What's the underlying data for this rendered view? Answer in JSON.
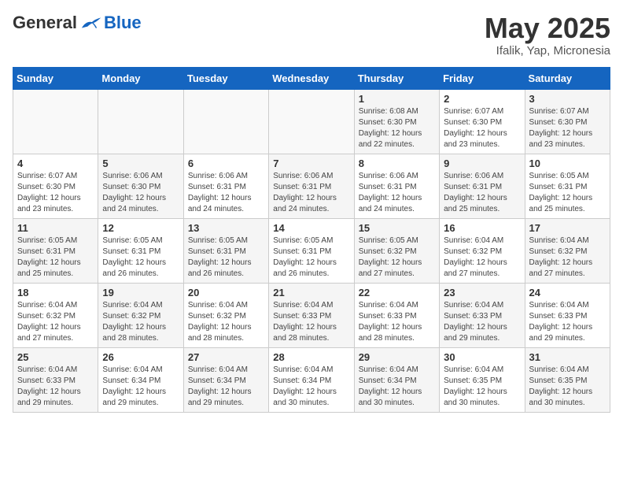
{
  "header": {
    "logo_general": "General",
    "logo_blue": "Blue",
    "month_title": "May 2025",
    "location": "Ifalik, Yap, Micronesia"
  },
  "days_of_week": [
    "Sunday",
    "Monday",
    "Tuesday",
    "Wednesday",
    "Thursday",
    "Friday",
    "Saturday"
  ],
  "weeks": [
    [
      {
        "day": "",
        "info": ""
      },
      {
        "day": "",
        "info": ""
      },
      {
        "day": "",
        "info": ""
      },
      {
        "day": "",
        "info": ""
      },
      {
        "day": "1",
        "info": "Sunrise: 6:08 AM\nSunset: 6:30 PM\nDaylight: 12 hours\nand 22 minutes."
      },
      {
        "day": "2",
        "info": "Sunrise: 6:07 AM\nSunset: 6:30 PM\nDaylight: 12 hours\nand 23 minutes."
      },
      {
        "day": "3",
        "info": "Sunrise: 6:07 AM\nSunset: 6:30 PM\nDaylight: 12 hours\nand 23 minutes."
      }
    ],
    [
      {
        "day": "4",
        "info": "Sunrise: 6:07 AM\nSunset: 6:30 PM\nDaylight: 12 hours\nand 23 minutes."
      },
      {
        "day": "5",
        "info": "Sunrise: 6:06 AM\nSunset: 6:30 PM\nDaylight: 12 hours\nand 24 minutes."
      },
      {
        "day": "6",
        "info": "Sunrise: 6:06 AM\nSunset: 6:31 PM\nDaylight: 12 hours\nand 24 minutes."
      },
      {
        "day": "7",
        "info": "Sunrise: 6:06 AM\nSunset: 6:31 PM\nDaylight: 12 hours\nand 24 minutes."
      },
      {
        "day": "8",
        "info": "Sunrise: 6:06 AM\nSunset: 6:31 PM\nDaylight: 12 hours\nand 24 minutes."
      },
      {
        "day": "9",
        "info": "Sunrise: 6:06 AM\nSunset: 6:31 PM\nDaylight: 12 hours\nand 25 minutes."
      },
      {
        "day": "10",
        "info": "Sunrise: 6:05 AM\nSunset: 6:31 PM\nDaylight: 12 hours\nand 25 minutes."
      }
    ],
    [
      {
        "day": "11",
        "info": "Sunrise: 6:05 AM\nSunset: 6:31 PM\nDaylight: 12 hours\nand 25 minutes."
      },
      {
        "day": "12",
        "info": "Sunrise: 6:05 AM\nSunset: 6:31 PM\nDaylight: 12 hours\nand 26 minutes."
      },
      {
        "day": "13",
        "info": "Sunrise: 6:05 AM\nSunset: 6:31 PM\nDaylight: 12 hours\nand 26 minutes."
      },
      {
        "day": "14",
        "info": "Sunrise: 6:05 AM\nSunset: 6:31 PM\nDaylight: 12 hours\nand 26 minutes."
      },
      {
        "day": "15",
        "info": "Sunrise: 6:05 AM\nSunset: 6:32 PM\nDaylight: 12 hours\nand 27 minutes."
      },
      {
        "day": "16",
        "info": "Sunrise: 6:04 AM\nSunset: 6:32 PM\nDaylight: 12 hours\nand 27 minutes."
      },
      {
        "day": "17",
        "info": "Sunrise: 6:04 AM\nSunset: 6:32 PM\nDaylight: 12 hours\nand 27 minutes."
      }
    ],
    [
      {
        "day": "18",
        "info": "Sunrise: 6:04 AM\nSunset: 6:32 PM\nDaylight: 12 hours\nand 27 minutes."
      },
      {
        "day": "19",
        "info": "Sunrise: 6:04 AM\nSunset: 6:32 PM\nDaylight: 12 hours\nand 28 minutes."
      },
      {
        "day": "20",
        "info": "Sunrise: 6:04 AM\nSunset: 6:32 PM\nDaylight: 12 hours\nand 28 minutes."
      },
      {
        "day": "21",
        "info": "Sunrise: 6:04 AM\nSunset: 6:33 PM\nDaylight: 12 hours\nand 28 minutes."
      },
      {
        "day": "22",
        "info": "Sunrise: 6:04 AM\nSunset: 6:33 PM\nDaylight: 12 hours\nand 28 minutes."
      },
      {
        "day": "23",
        "info": "Sunrise: 6:04 AM\nSunset: 6:33 PM\nDaylight: 12 hours\nand 29 minutes."
      },
      {
        "day": "24",
        "info": "Sunrise: 6:04 AM\nSunset: 6:33 PM\nDaylight: 12 hours\nand 29 minutes."
      }
    ],
    [
      {
        "day": "25",
        "info": "Sunrise: 6:04 AM\nSunset: 6:33 PM\nDaylight: 12 hours\nand 29 minutes."
      },
      {
        "day": "26",
        "info": "Sunrise: 6:04 AM\nSunset: 6:34 PM\nDaylight: 12 hours\nand 29 minutes."
      },
      {
        "day": "27",
        "info": "Sunrise: 6:04 AM\nSunset: 6:34 PM\nDaylight: 12 hours\nand 29 minutes."
      },
      {
        "day": "28",
        "info": "Sunrise: 6:04 AM\nSunset: 6:34 PM\nDaylight: 12 hours\nand 30 minutes."
      },
      {
        "day": "29",
        "info": "Sunrise: 6:04 AM\nSunset: 6:34 PM\nDaylight: 12 hours\nand 30 minutes."
      },
      {
        "day": "30",
        "info": "Sunrise: 6:04 AM\nSunset: 6:35 PM\nDaylight: 12 hours\nand 30 minutes."
      },
      {
        "day": "31",
        "info": "Sunrise: 6:04 AM\nSunset: 6:35 PM\nDaylight: 12 hours\nand 30 minutes."
      }
    ]
  ]
}
